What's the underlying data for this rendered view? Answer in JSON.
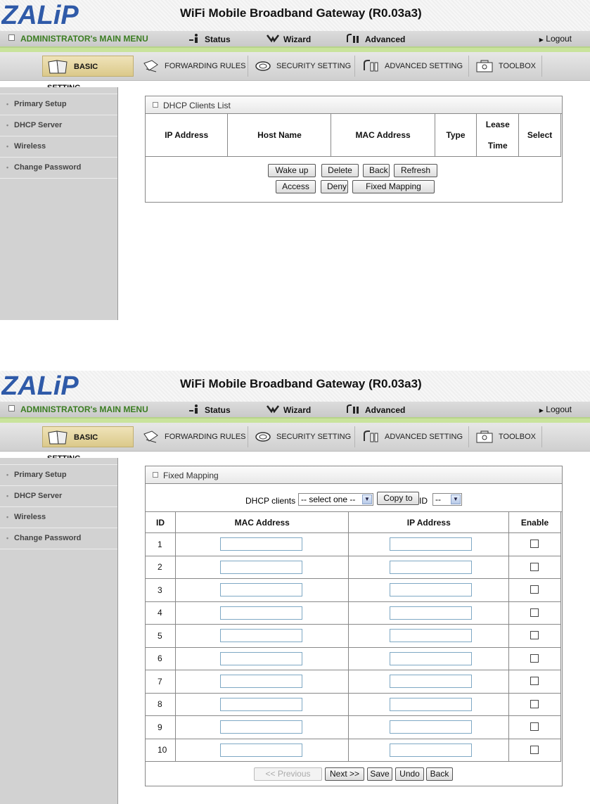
{
  "gateway_title": "WiFi Mobile Broadband Gateway (R0.03a3)",
  "logo_text": "ZALiP",
  "menu": {
    "admin": "ADMINISTRATOR's MAIN MENU",
    "status": "Status",
    "wizard": "Wizard",
    "advanced": "Advanced",
    "logout": "Logout"
  },
  "tabs": [
    "BASIC SETTING",
    "FORWARDING RULES",
    "SECURITY SETTING",
    "ADVANCED SETTING",
    "TOOLBOX"
  ],
  "sidebar": [
    "Primary Setup",
    "DHCP Server",
    "Wireless",
    "Change Password"
  ],
  "dhcp_clients_list": {
    "title": "DHCP Clients List",
    "headers": [
      "IP Address",
      "Host Name",
      "MAC Address",
      "Type",
      "Lease",
      "Time",
      "Select"
    ],
    "buttons_row1": [
      "Wake up",
      "Delete",
      "Back",
      "Refresh"
    ],
    "buttons_row2": [
      "Access",
      "Deny",
      "Fixed Mapping"
    ]
  },
  "fixed_mapping": {
    "title": "Fixed Mapping",
    "dhcp_clients_label": "DHCP clients",
    "dhcp_clients_select": "-- select one --",
    "copy_to_label": "Copy to",
    "id_label": "ID",
    "id_select": "--",
    "headers": [
      "ID",
      "MAC Address",
      "IP Address",
      "Enable"
    ],
    "rows": [
      "1",
      "2",
      "3",
      "4",
      "5",
      "6",
      "7",
      "8",
      "9",
      "10"
    ],
    "buttons": [
      "<< Previous",
      "Next >>",
      "Save",
      "Undo",
      "Back"
    ]
  },
  "colors": {
    "admin_text": "#3b7d22",
    "green_line": "#c9e39c",
    "active_tab": "#dbc98a",
    "sidebar_bg": "#d2d2d2",
    "logo": "#2f5aa8"
  }
}
